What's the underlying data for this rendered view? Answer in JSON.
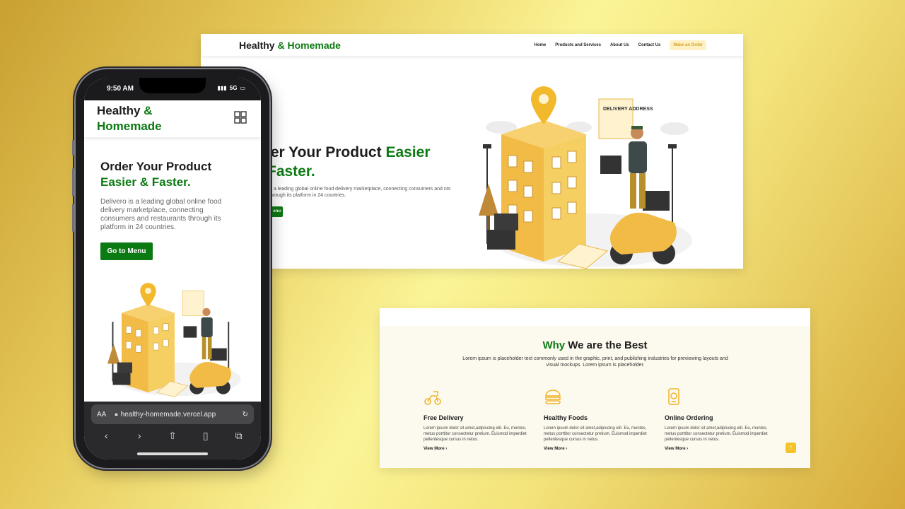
{
  "desktop": {
    "brand": {
      "part1": "Healthy",
      "part2": "& Homemade"
    },
    "nav": {
      "home": "Home",
      "products": "Products and Services",
      "about": "About Us",
      "contact": "Contact Us",
      "cta": "Make an Order"
    },
    "hero": {
      "title_line1_a": "der Your Product",
      "title_line1_b": "Easier",
      "title_line2": "Faster.",
      "desc": "is a leading global online food delivery marketplace, connecting consumers and nts through its platform in 24 countries.",
      "button": "enu"
    },
    "illustration_sign": "DELIVERY ADDRESS"
  },
  "why": {
    "title_a": "Why",
    "title_b": "We are the Best",
    "subtitle": "Lorem ipsum is placeholder text commonly used in the graphic, print, and publishing industries for previewing layouts and visual mockups. Lorem ipsum is placeholder.",
    "features": [
      {
        "icon": "scooter-icon",
        "title": "Free Delivery",
        "desc": "Lorem ipsum dolor sit amet,adipiscing elit. Eu, montes, metus porttitor consectetur pretium. Euismod imperdiet pellentesque cursus in netus.",
        "link": "View More"
      },
      {
        "icon": "burger-icon",
        "title": "Healthy Foods",
        "desc": "Lorem ipsum dolor sit amet,adipiscing elit. Eu, montes, metus porttitor consectetur pretium. Euismod imperdiet pellentesque cursus in netus.",
        "link": "View More"
      },
      {
        "icon": "phone-order-icon",
        "title": "Online Ordering",
        "desc": "Lorem ipsum dolor sit amet,adipiscing elit. Eu, montes, metus porttitor consectetur pretium. Euismod imperdiet pellentesque cursus in netus.",
        "link": "View More"
      }
    ],
    "to_top": "↑"
  },
  "phone": {
    "status": {
      "time": "9:50 AM",
      "network": "5G"
    },
    "brand": {
      "part1": "Healthy",
      "part2": "& Homemade"
    },
    "hero": {
      "title_line1": "Order Your Product",
      "title_line2": "Easier & Faster.",
      "desc": "Delivero is a leading global online food delivery marketplace, connecting consumers and restaurants through its platform in 24 countries.",
      "button": "Go to Menu"
    },
    "safari": {
      "aa": "AA",
      "url": "healthy-homemade.vercel.app"
    }
  },
  "colors": {
    "green": "#0c7a12",
    "accent": "#f4c325",
    "cream": "#fcf9ee"
  }
}
